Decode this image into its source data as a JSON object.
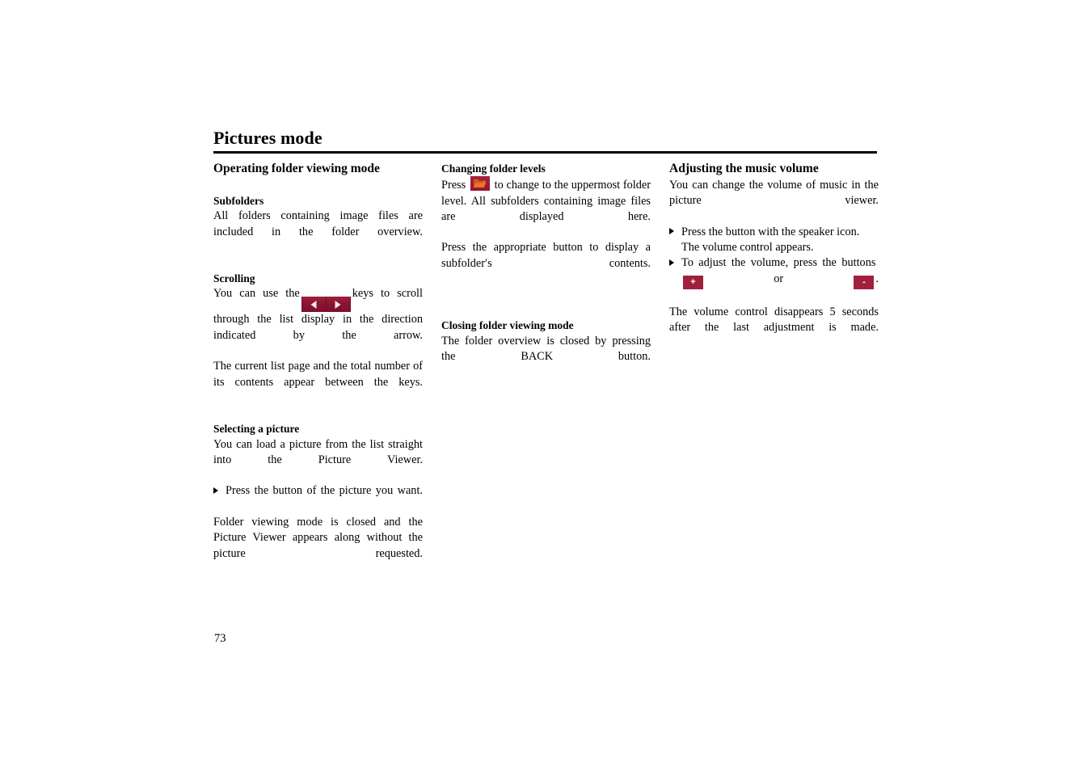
{
  "document": {
    "title": "Pictures mode",
    "page_number": "73"
  },
  "columns": {
    "column1": {
      "section_heading": "Operating folder viewing mode",
      "subfolders": {
        "heading": "Subfolders",
        "text": "All folders containing image files are included in the folder overview."
      },
      "scrolling": {
        "heading": "Scrolling",
        "text_before_keys": "You can use the",
        "text_after_keys": "keys to scroll through the list display in the direction indicated by the arrow.",
        "text_para2": "The current list page and the total number of its contents appear between the keys.",
        "icon_left": "arrow-left-key-icon",
        "icon_right": "arrow-right-key-icon"
      },
      "selecting_picture": {
        "heading": "Selecting a picture",
        "text1": "You can load a picture from the list straight into the Picture Viewer.",
        "bullet1": "Press the button of the picture you want.",
        "text2": "Folder viewing mode is closed and the Picture Viewer appears along without the picture requested."
      }
    },
    "column2": {
      "changing_levels": {
        "heading": "Changing folder levels",
        "text_before_icon": "Press",
        "text_after_icon": "to change to the uppermost folder level. All subfolders containing image files are displayed here.",
        "text_para2": "Press the appropriate button to display a subfolderʹs contents.",
        "icon": "folder-up-key-icon"
      },
      "closing": {
        "heading": "Closing folder viewing mode",
        "text": "The folder overview is closed by pressing the BACK button."
      }
    },
    "column3": {
      "volume": {
        "heading": "Adjusting the music volume",
        "text1": "You can change the volume of music in the picture viewer.",
        "bullet1": "Press the button with the speaker icon. The volume control appears.",
        "bullet2_before": "To adjust the volume, press the buttons",
        "bullet2_or": "or",
        "bullet2_after": ".",
        "plus_label": "+",
        "minus_label": "-",
        "text2": "The volume control disappears 5 seconds after the last adjustment is made."
      }
    }
  },
  "colors": {
    "key_red": "#A0203C",
    "key_red_dark": "#7D0F2A",
    "folder_glyph": "#E8762A",
    "text": "#000000"
  }
}
